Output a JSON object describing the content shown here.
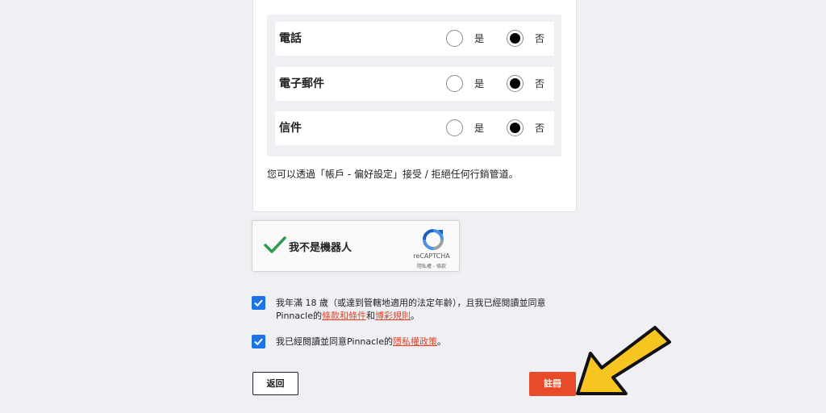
{
  "preferences": {
    "rows": [
      {
        "label": "電話",
        "yes": "是",
        "no": "否",
        "selected": "no"
      },
      {
        "label": "電子郵件",
        "yes": "是",
        "no": "否",
        "selected": "no"
      },
      {
        "label": "信件",
        "yes": "是",
        "no": "否",
        "selected": "no"
      }
    ],
    "note": "您可以透過「帳戶 - 偏好設定」接受 / 拒絕任何行銷管道。"
  },
  "captcha": {
    "label": "我不是機器人",
    "brand": "reCAPTCHA",
    "links": "隱私權 - 條款"
  },
  "agreements": {
    "age": {
      "line1": "我年滿 18 歲（或達到管轄地適用的法定年齡），且我已經閱讀並同意",
      "prefix2": "Pinnacle的",
      "terms_link": "條款和條件",
      "conj": "和",
      "rules_link": "博彩規則",
      "suffix": "。"
    },
    "privacy": {
      "prefix": "我已經閱讀並同意Pinnacle的",
      "policy_link": "隱私權政策",
      "suffix": "。"
    }
  },
  "buttons": {
    "back": "返回",
    "register": "註冊"
  },
  "colors": {
    "accent": "#e84b2a",
    "checkbox": "#1b73e8",
    "link": "#e0452b",
    "arrow": "#f7c51f"
  }
}
